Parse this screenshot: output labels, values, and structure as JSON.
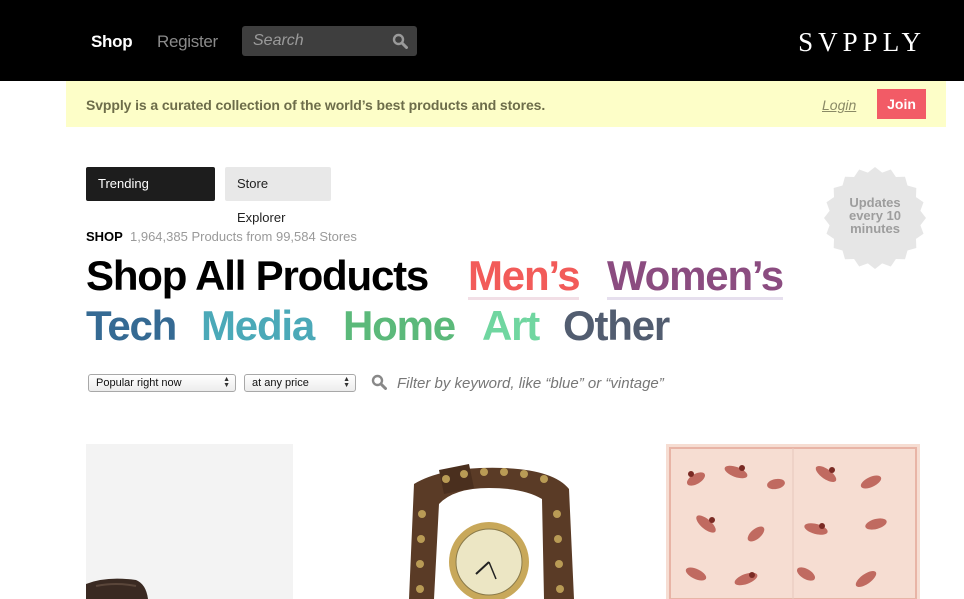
{
  "header": {
    "nav": {
      "shop": "Shop",
      "register": "Register"
    },
    "search": {
      "placeholder": "Search"
    },
    "logo": "SVPPLY"
  },
  "banner": {
    "text": "Svpply is a curated collection of the world’s best products and stores.",
    "login": "Login",
    "join": "Join"
  },
  "tabs": {
    "trending": "Trending Products",
    "store_explorer": "Store Explorer"
  },
  "badge": {
    "line1": "Updates",
    "line2": "every 10",
    "line3": "minutes"
  },
  "shop": {
    "label": "SHOP",
    "stats": "1,964,385 Products from 99,584 Stores",
    "categories": {
      "all": "Shop All Products",
      "mens": "Men’s",
      "womens": "Women’s",
      "tech": "Tech",
      "media": "Media",
      "home": "Home",
      "art": "Art",
      "other": "Other"
    }
  },
  "filters": {
    "sort": "Popular right now",
    "price": "at any price",
    "keyword_placeholder": "Filter by keyword, like “blue” or “vintage”"
  },
  "colors": {
    "mens": "#f25b59",
    "womens": "#8b4c80",
    "tech": "#356a93",
    "media": "#4ba9b8",
    "home": "#5bb97a",
    "art": "#70d6a0",
    "other": "#525d70",
    "join": "#f25b66",
    "banner_bg": "#fdfec8"
  },
  "products": [
    {
      "icon": "boot-product-image"
    },
    {
      "icon": "studded-wrap-watch-product-image"
    },
    {
      "icon": "pinup-print-scarf-product-image"
    }
  ]
}
